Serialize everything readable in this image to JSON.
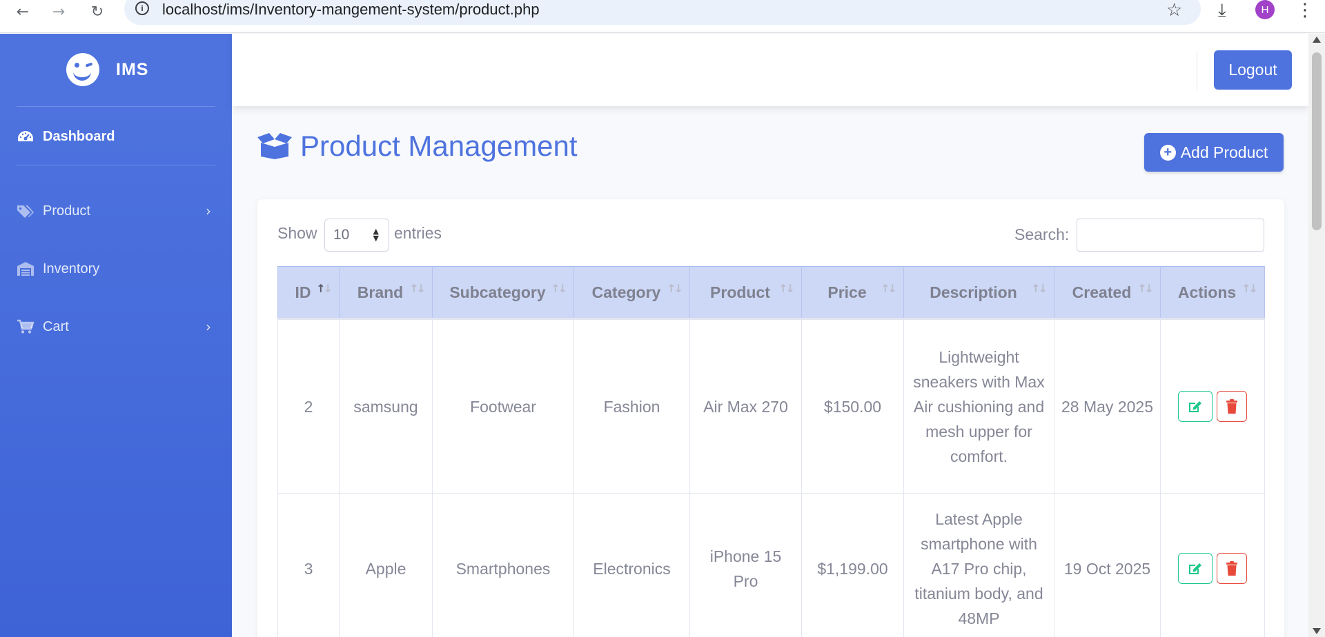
{
  "browser": {
    "url": "localhost/ims/Inventory-mangement-system/product.php",
    "profile_initial": "H"
  },
  "sidebar": {
    "brand": "IMS",
    "items": [
      {
        "label": "Dashboard",
        "icon": "tachometer-icon"
      },
      {
        "label": "Product",
        "icon": "tags-icon"
      },
      {
        "label": "Inventory",
        "icon": "warehouse-icon"
      },
      {
        "label": "Cart",
        "icon": "cart-icon"
      }
    ]
  },
  "topbar": {
    "logout_label": "Logout"
  },
  "page": {
    "title": "Product Management",
    "add_label": "Add Product"
  },
  "table_controls": {
    "show_label": "Show",
    "page_length": "10",
    "entries_label": "entries",
    "search_label": "Search:",
    "search_value": ""
  },
  "table": {
    "columns": [
      "ID",
      "Brand",
      "Subcategory",
      "Category",
      "Product",
      "Price",
      "Description",
      "Created",
      "Actions"
    ],
    "rows": [
      {
        "id": "2",
        "brand": "samsung",
        "subcategory": "Footwear",
        "category": "Fashion",
        "product": "Air Max 270",
        "price": "$150.00",
        "description": "Lightweight sneakers with Max Air cushioning and mesh upper for comfort.",
        "created": "28 May 2025"
      },
      {
        "id": "3",
        "brand": "Apple",
        "subcategory": "Smartphones",
        "category": "Electronics",
        "product": "iPhone 15 Pro",
        "price": "$1,199.00",
        "description": "Latest Apple smartphone with A17 Pro chip, titanium body, and 48MP",
        "created": "19 Oct 2025"
      }
    ]
  },
  "colors": {
    "primary": "#4e73df",
    "success": "#1cc88a",
    "danger": "#e74a3b",
    "table_header": "#cdd8f6"
  }
}
